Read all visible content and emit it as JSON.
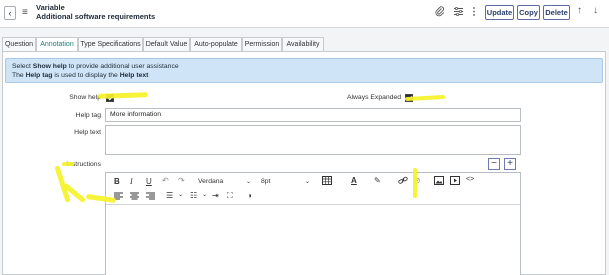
{
  "header": {
    "record_type": "Variable",
    "record_name": "Additional software requirements",
    "buttons": {
      "update": "Update",
      "copy": "Copy",
      "delete": "Delete"
    }
  },
  "tabs": [
    {
      "label": "Question"
    },
    {
      "label": "Annotation"
    },
    {
      "label": "Type Specifications"
    },
    {
      "label": "Default Value"
    },
    {
      "label": "Auto-populate"
    },
    {
      "label": "Permission"
    },
    {
      "label": "Availability"
    }
  ],
  "info": {
    "line1_pre": "Select ",
    "line1_bold": "Show help",
    "line1_post": " to provide additional user assistance",
    "line2_pre": "The ",
    "line2_bold1": "Help tag",
    "line2_mid": " is used to display the ",
    "line2_bold2": "Help text"
  },
  "form": {
    "show_help_label": "Show help",
    "show_help_checked": true,
    "always_expanded_label": "Always Expanded",
    "always_expanded_checked": true,
    "help_tag_label": "Help tag",
    "help_tag_value": "More information",
    "help_text_label": "Help text",
    "help_text_value": "",
    "instructions_label": "Instructions"
  },
  "editor": {
    "bold": "B",
    "italic": "I",
    "underline": "U",
    "font_family": "Verdana",
    "font_size": "8pt"
  },
  "colors": {
    "accent": "#1d7f73",
    "info_bg": "#cfe5f7",
    "highlight": "#f5f228"
  }
}
